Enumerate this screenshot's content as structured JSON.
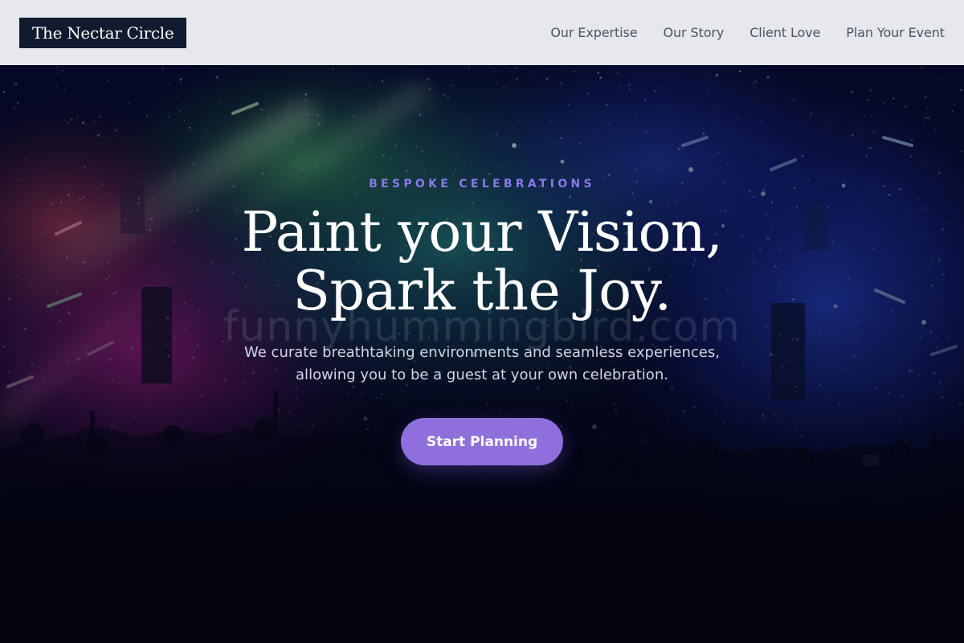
{
  "header": {
    "logo_text": "The Nectar Circle",
    "nav": [
      {
        "label": "Our Expertise"
      },
      {
        "label": "Our Story"
      },
      {
        "label": "Client Love"
      },
      {
        "label": "Plan Your Event"
      }
    ]
  },
  "hero": {
    "eyebrow": "BESPOKE CELEBRATIONS",
    "headline_line1": "Paint your Vision,",
    "headline_line2": "Spark the Joy.",
    "subhead_line1": "We curate breathtaking environments and seamless experiences,",
    "subhead_line2": "allowing you to be a guest at your own celebration.",
    "cta_label": "Start Planning",
    "watermark": "funnyhummingbird.com",
    "background": "concert-crowd-photo"
  },
  "colors": {
    "header_bg": "#e6e8eb",
    "logo_bg": "#111a2e",
    "nav_text": "#4a5466",
    "eyebrow": "#8b79e6",
    "accent_button": "#8e6fdc",
    "hero_dark": "#03040f"
  }
}
